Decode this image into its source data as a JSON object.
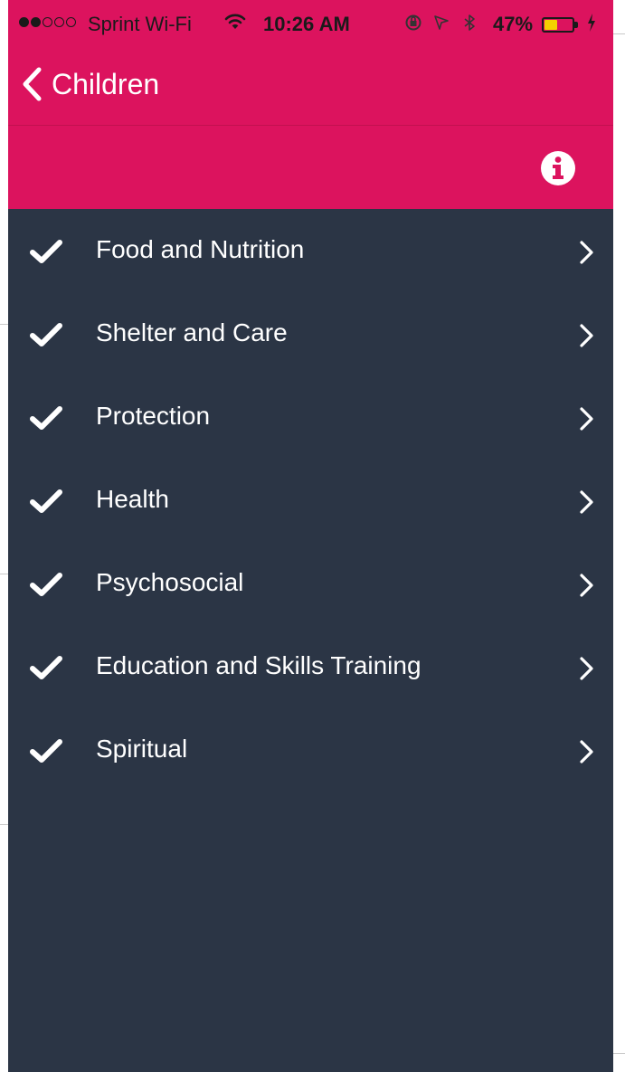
{
  "status_bar": {
    "carrier": "Sprint Wi-Fi",
    "time": "10:26 AM",
    "battery_percent": "47%",
    "battery_level": 0.47,
    "signal_bars_filled": 2,
    "signal_bars_total": 5
  },
  "nav": {
    "back_label": "Children"
  },
  "list": {
    "items": [
      {
        "label": "Food and Nutrition",
        "checked": true
      },
      {
        "label": "Shelter and Care",
        "checked": true
      },
      {
        "label": "Protection",
        "checked": true
      },
      {
        "label": "Health",
        "checked": true
      },
      {
        "label": "Psychosocial",
        "checked": true
      },
      {
        "label": "Education and Skills Training",
        "checked": true
      },
      {
        "label": "Spiritual",
        "checked": true
      }
    ]
  },
  "colors": {
    "header": "#dc135e",
    "background": "#2b3545",
    "text": "#ffffff",
    "battery": "#f4d000"
  },
  "icons": {
    "back": "chevron-left-icon",
    "info": "info-icon",
    "check": "checkmark-icon",
    "row_chevron": "chevron-right-icon"
  }
}
